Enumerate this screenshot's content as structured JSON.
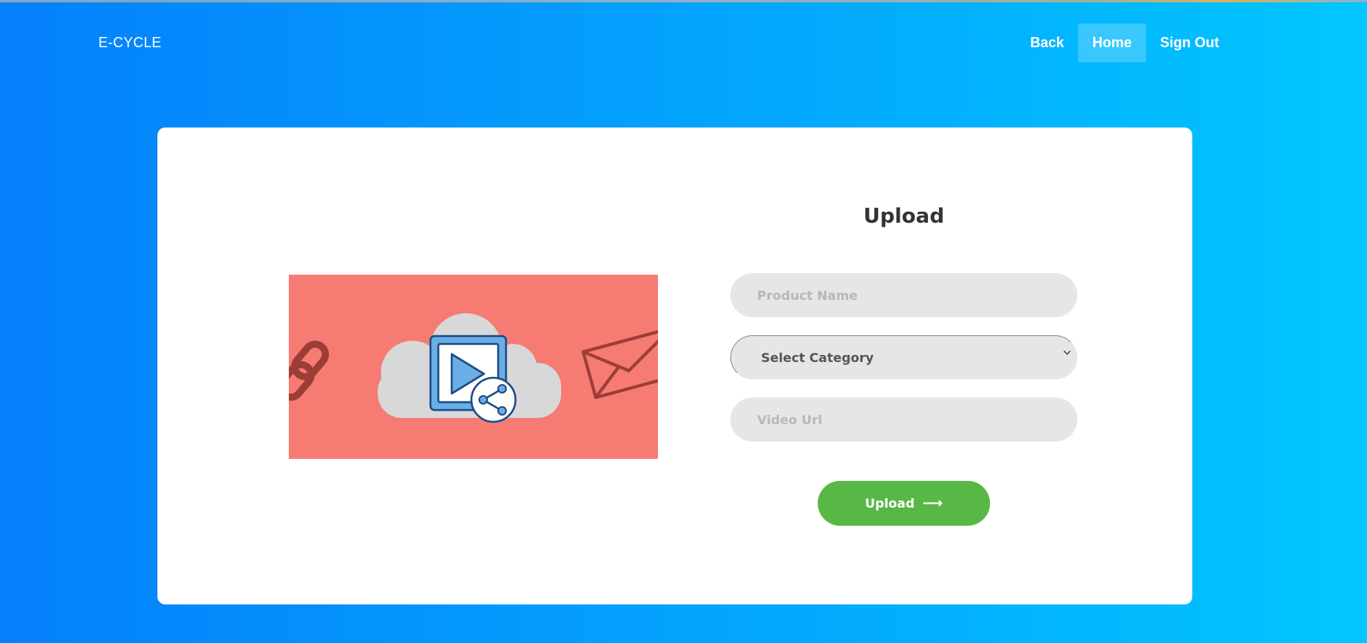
{
  "header": {
    "brand": "E-CYCLE",
    "nav": [
      {
        "label": "Back",
        "active": false
      },
      {
        "label": "Home",
        "active": true
      },
      {
        "label": "Sign Out",
        "active": false
      }
    ]
  },
  "upload_form": {
    "title": "Upload",
    "product_name_placeholder": "Product Name",
    "category_selected": "Select Category",
    "video_url_placeholder": "Video Url",
    "submit_label": "Upload",
    "submit_icon": "arrow-right-icon"
  },
  "illustration": {
    "icons": [
      "chain-link-icon",
      "cloud-icon",
      "video-play-icon",
      "share-icon",
      "envelope-icon"
    ]
  },
  "colors": {
    "background_start": "#0580fb",
    "background_end": "#02c6fe",
    "card": "#ffffff",
    "illustration_bg": "#f67b72",
    "input_bg": "#e6e6e6",
    "button": "#57b846",
    "title": "#333333"
  }
}
